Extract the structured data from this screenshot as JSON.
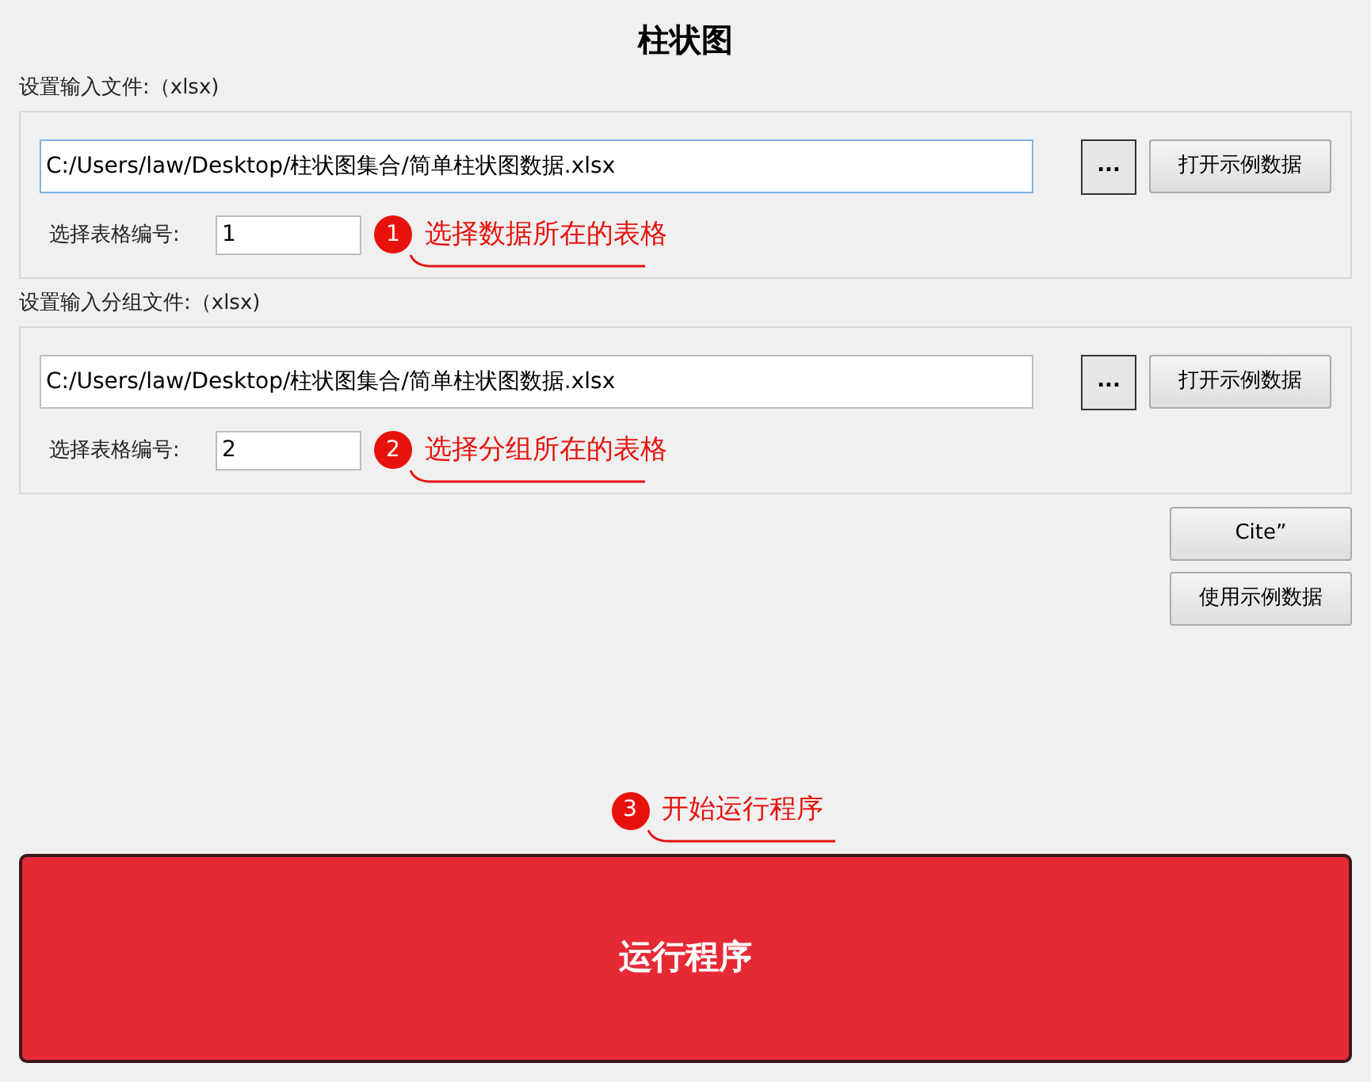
{
  "title": "柱状图",
  "file_groups": [
    {
      "label": "设置输入文件:（xlsx)",
      "path": "C:/Users/law/Desktop/柱状图集合/简单柱状图数据.xlsx",
      "focused": true,
      "browse_button": "...",
      "example_button": "打开示例数据",
      "sheet_label": "选择表格编号:",
      "sheet_value": "1",
      "callout": {
        "number": "1",
        "text": "选择数据所在的表格"
      }
    },
    {
      "label": "设置输入分组文件:（xlsx)",
      "path": "C:/Users/law/Desktop/柱状图集合/简单柱状图数据.xlsx",
      "focused": false,
      "browse_button": "...",
      "example_button": "打开示例数据",
      "sheet_label": "选择表格编号:",
      "sheet_value": "2",
      "callout": {
        "number": "2",
        "text": "选择分组所在的表格"
      }
    }
  ],
  "side_buttons": [
    "Cite”",
    "使用示例数据"
  ],
  "run_callout": {
    "number": "3",
    "text": "开始运行程序"
  },
  "run_button": "运行程序"
}
